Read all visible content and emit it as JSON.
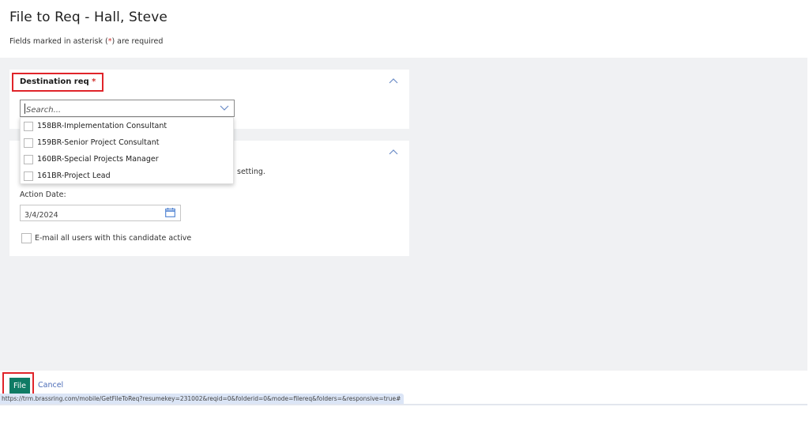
{
  "header": {
    "title": "File to Req - Hall, Steve",
    "required_note_prefix": "Fields marked in asterisk (",
    "required_note_star": "*",
    "required_note_suffix": ") are required"
  },
  "destination": {
    "label": "Destination req",
    "required_star": "*",
    "search_placeholder": "Search...",
    "options": [
      {
        "label": "158BR-Implementation Consultant",
        "checked": false
      },
      {
        "label": "159BR-Senior Project Consultant",
        "checked": false
      },
      {
        "label": "160BR-Special Projects Manager",
        "checked": false
      },
      {
        "label": "161BR-Project Lead",
        "checked": false
      }
    ]
  },
  "options_panel": {
    "partial_text": "setting.",
    "action_date_label": "Action Date:",
    "action_date_value": "3/4/2024",
    "email_label": "E-mail all users with this candidate active",
    "email_checked": false
  },
  "footer": {
    "file_label": "File",
    "cancel_label": "Cancel",
    "status_url": "https://trm.brassring.com/mobile/GetFileToReq?resumekey=231002&reqid=0&folderid=0&mode=filereq&folders=&responsive=true#"
  },
  "colors": {
    "accent_button": "#0f7b65",
    "highlight_red": "#e0242a",
    "required_star": "#d0312d",
    "link": "#4a6bb8",
    "background_gray": "#f0f1f3"
  }
}
